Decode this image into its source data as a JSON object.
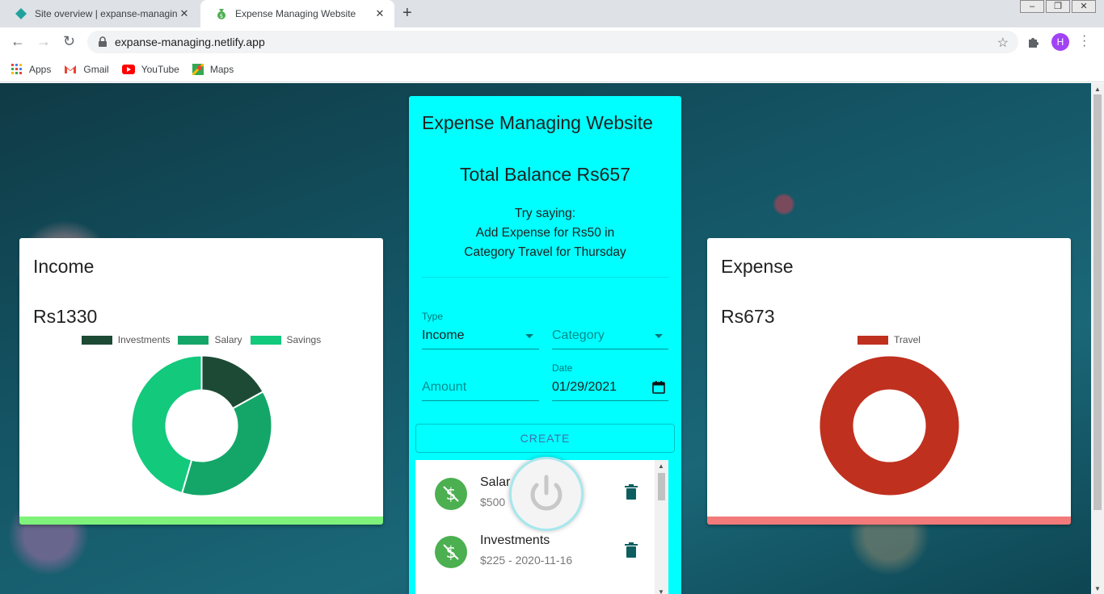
{
  "browser": {
    "tabs": [
      {
        "title": "Site overview | expanse-managing",
        "active": false,
        "close": "✕"
      },
      {
        "title": "Expense Managing Website",
        "active": true,
        "close": "✕"
      }
    ],
    "new_tab": "+",
    "url": "expanse-managing.netlify.app",
    "profile_initial": "H",
    "bookmarks": [
      {
        "label": "Apps",
        "icon": "apps-grid-icon"
      },
      {
        "label": "Gmail",
        "icon": "gmail-icon"
      },
      {
        "label": "YouTube",
        "icon": "youtube-icon"
      },
      {
        "label": "Maps",
        "icon": "maps-icon"
      }
    ]
  },
  "app": {
    "title": "Expense Managing Website",
    "balance": "Total Balance Rs657",
    "hint": {
      "line1": "Try saying:",
      "line2": "Add Expense for Rs50 in",
      "line3": "Category Travel for Thursday"
    },
    "form": {
      "type_label": "Type",
      "type_value": "Income",
      "category_placeholder": "Category",
      "amount_placeholder": "Amount",
      "date_label": "Date",
      "date_value": "01/29/2021",
      "create_label": "CREATE"
    },
    "transactions": [
      {
        "name": "Salary",
        "visible_name": "Salar",
        "detail": "$500",
        "visible_detail": "$500"
      },
      {
        "name": "Investments",
        "visible_name": "Investments",
        "detail": "$225 - 2020-11-16",
        "visible_detail": "$225 - 2020-11-16"
      }
    ]
  },
  "income": {
    "title": "Income",
    "amount": "Rs1330",
    "accent_color": "#7ef27a",
    "chart_data": {
      "type": "pie",
      "categories": [
        "Investments",
        "Salary",
        "Savings"
      ],
      "values": [
        225,
        500,
        605
      ],
      "colors": [
        "#1d4a34",
        "#13a668",
        "#12c97c"
      ]
    }
  },
  "expense": {
    "title": "Expense",
    "amount": "Rs673",
    "accent_color": "#f27a7a",
    "chart_data": {
      "type": "pie",
      "categories": [
        "Travel"
      ],
      "values": [
        673
      ],
      "colors": [
        "#c0301f"
      ]
    }
  }
}
